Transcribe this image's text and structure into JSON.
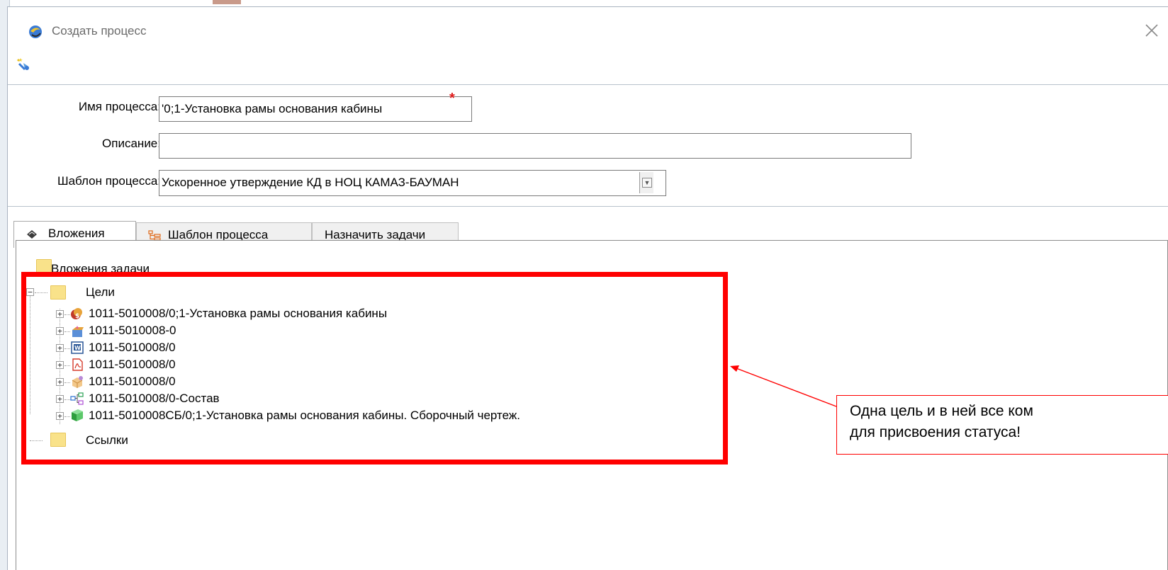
{
  "dialog": {
    "title": "Создать процесс"
  },
  "form": {
    "name_label": "Имя процесса:",
    "name_value": "'0;1-Установка рамы основания кабины",
    "description_label": "Описание:",
    "description_value": "",
    "template_label": "Шаблон процесса:",
    "template_value": "Ускоренное утверждение КД в НОЦ КАМАЗ-БАУМАН"
  },
  "tabs": [
    {
      "label": "Вложения",
      "active": true,
      "icon": "attachments-icon"
    },
    {
      "label": "Шаблон процесса",
      "active": false,
      "icon": "process-template-icon"
    },
    {
      "label": "Назначить задачи",
      "active": false
    }
  ],
  "tree": {
    "root_label": "Вложения задачи",
    "targets_label": "Цели",
    "items": [
      {
        "label": "1011-5010008/0;1-Установка рамы основания кабины",
        "icon": "item-revision-icon"
      },
      {
        "label": "1011-5010008-0",
        "icon": "dataset-icon"
      },
      {
        "label": "1011-5010008/0",
        "icon": "word-document-icon"
      },
      {
        "label": "1011-5010008/0",
        "icon": "pdf-document-icon"
      },
      {
        "label": "1011-5010008/0",
        "icon": "cad-model-icon"
      },
      {
        "label": "1011-5010008/0-Состав",
        "icon": "bom-structure-icon"
      },
      {
        "label": "1011-5010008СБ/0;1-Установка рамы основания кабины. Сборочный чертеж.",
        "icon": "drawing-icon"
      }
    ],
    "links_label": "Ссылки"
  },
  "annotation": {
    "line1": "Одна цель и в ней все ком",
    "line2": "для присвоения статуса!",
    "color": "#ff0000"
  }
}
